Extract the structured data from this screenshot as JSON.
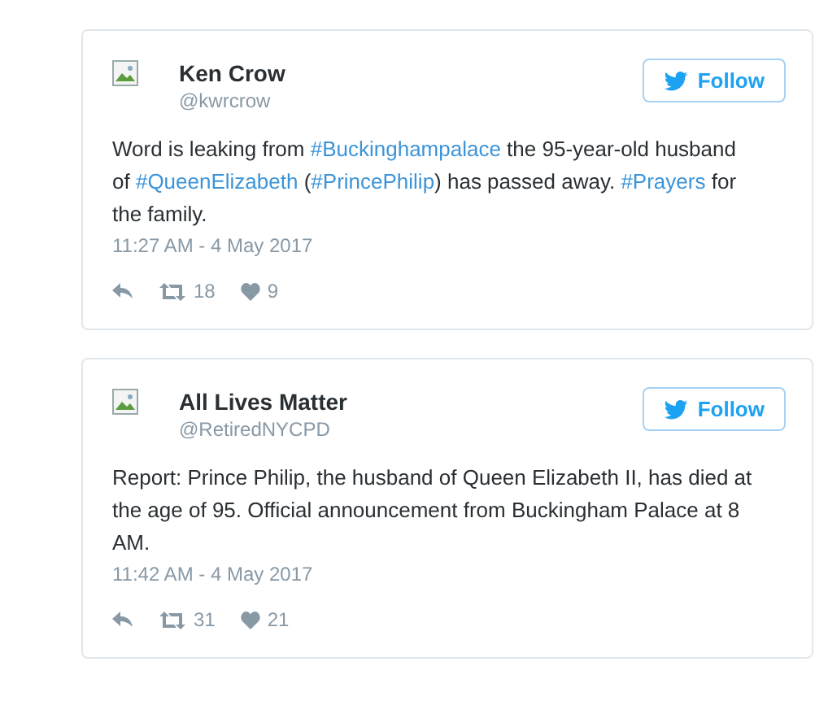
{
  "tweets": [
    {
      "name": "Ken Crow",
      "handle": "@kwrcrow",
      "follow": "Follow",
      "text": [
        {
          "kind": "text",
          "value": "Word is leaking from "
        },
        {
          "kind": "hashtag",
          "value": "#Buckinghampalace"
        },
        {
          "kind": "text",
          "value": " the 95-year-old husband of "
        },
        {
          "kind": "hashtag",
          "value": "#QueenElizabeth"
        },
        {
          "kind": "text",
          "value": " ("
        },
        {
          "kind": "hashtag",
          "value": "#PrincePhilip"
        },
        {
          "kind": "text",
          "value": ") has passed away. "
        },
        {
          "kind": "hashtag",
          "value": "#Prayers"
        },
        {
          "kind": "text",
          "value": " for the family."
        }
      ],
      "time": "11:27 AM - 4 May 2017",
      "retweets": "18",
      "likes": "9"
    },
    {
      "name": "All Lives Matter",
      "handle": "@RetiredNYCPD",
      "follow": "Follow",
      "text": [
        {
          "kind": "text",
          "value": "Report: Prince Philip, the husband of Queen Elizabeth II, has died at the age of 95. Official announcement from Buckingham Palace at 8 AM."
        }
      ],
      "time": "11:42 AM - 4 May 2017",
      "retweets": "31",
      "likes": "21"
    }
  ]
}
